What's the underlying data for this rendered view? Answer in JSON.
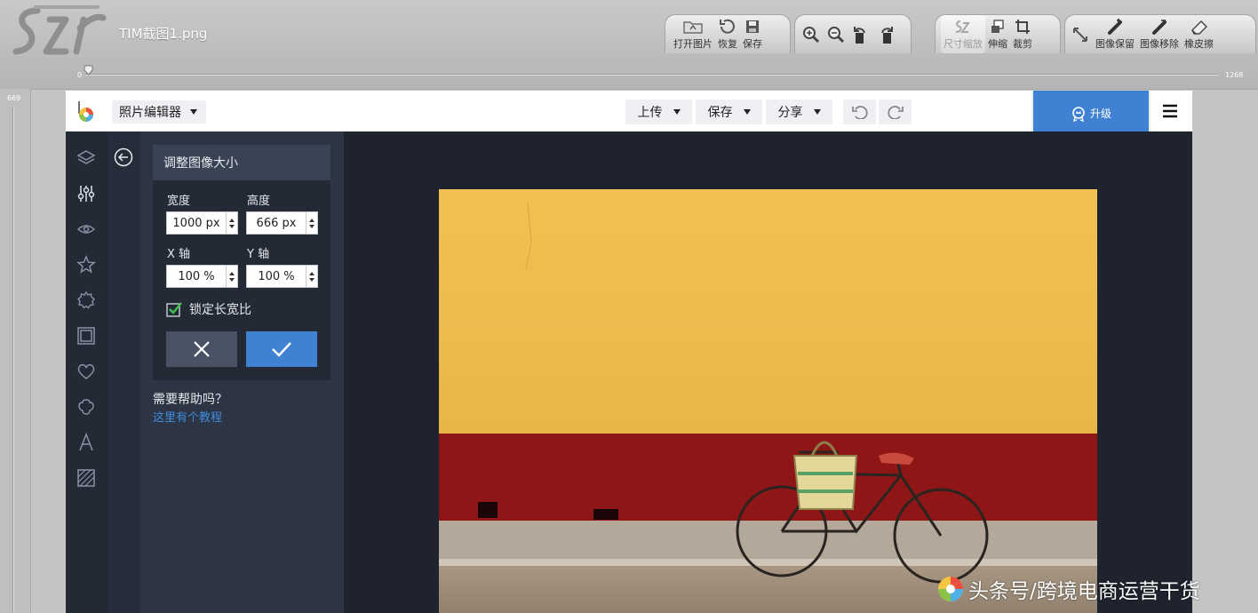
{
  "app": {
    "file_title": "TIM截图1.png",
    "toolbar": {
      "open_label": "打开图片",
      "restore_label": "恢复",
      "save_label": "保存",
      "resize_label": "尺寸缩放",
      "stretch_label": "伸缩",
      "crop_label": "裁剪",
      "keep_label": "图像保留",
      "remove_label": "图像移除",
      "eraser_label": "橡皮擦"
    },
    "ruler": {
      "min": "0",
      "max": "1268",
      "vertical_value": "669"
    }
  },
  "editor": {
    "app_select": "照片编辑器",
    "menus": {
      "upload": "上传",
      "save": "保存",
      "share": "分享"
    },
    "upgrade_label": "升级",
    "tools": [
      "layers-icon",
      "adjust-icon",
      "eye-icon",
      "star-icon",
      "gear-badge-icon",
      "frame-icon",
      "heart-icon",
      "flower-icon",
      "text-icon",
      "texture-icon"
    ],
    "panel": {
      "title": "调整图像大小",
      "width_label": "宽度",
      "height_label": "高度",
      "width_value": "1000 px",
      "height_value": "666 px",
      "x_label": "X 轴",
      "y_label": "Y 轴",
      "x_value": "100 %",
      "y_value": "100 %",
      "lock_label": "锁定长宽比",
      "lock_checked": true,
      "help_title": "需要帮助吗？",
      "help_link": "这里有个教程"
    }
  },
  "watermark": {
    "text": "头条号/跨境电商运营干货"
  },
  "colors": {
    "accent": "#3f82d4",
    "editor_bg": "#1e232d",
    "panel_bg": "#2d3444",
    "checkmark": "#3ec24a"
  }
}
